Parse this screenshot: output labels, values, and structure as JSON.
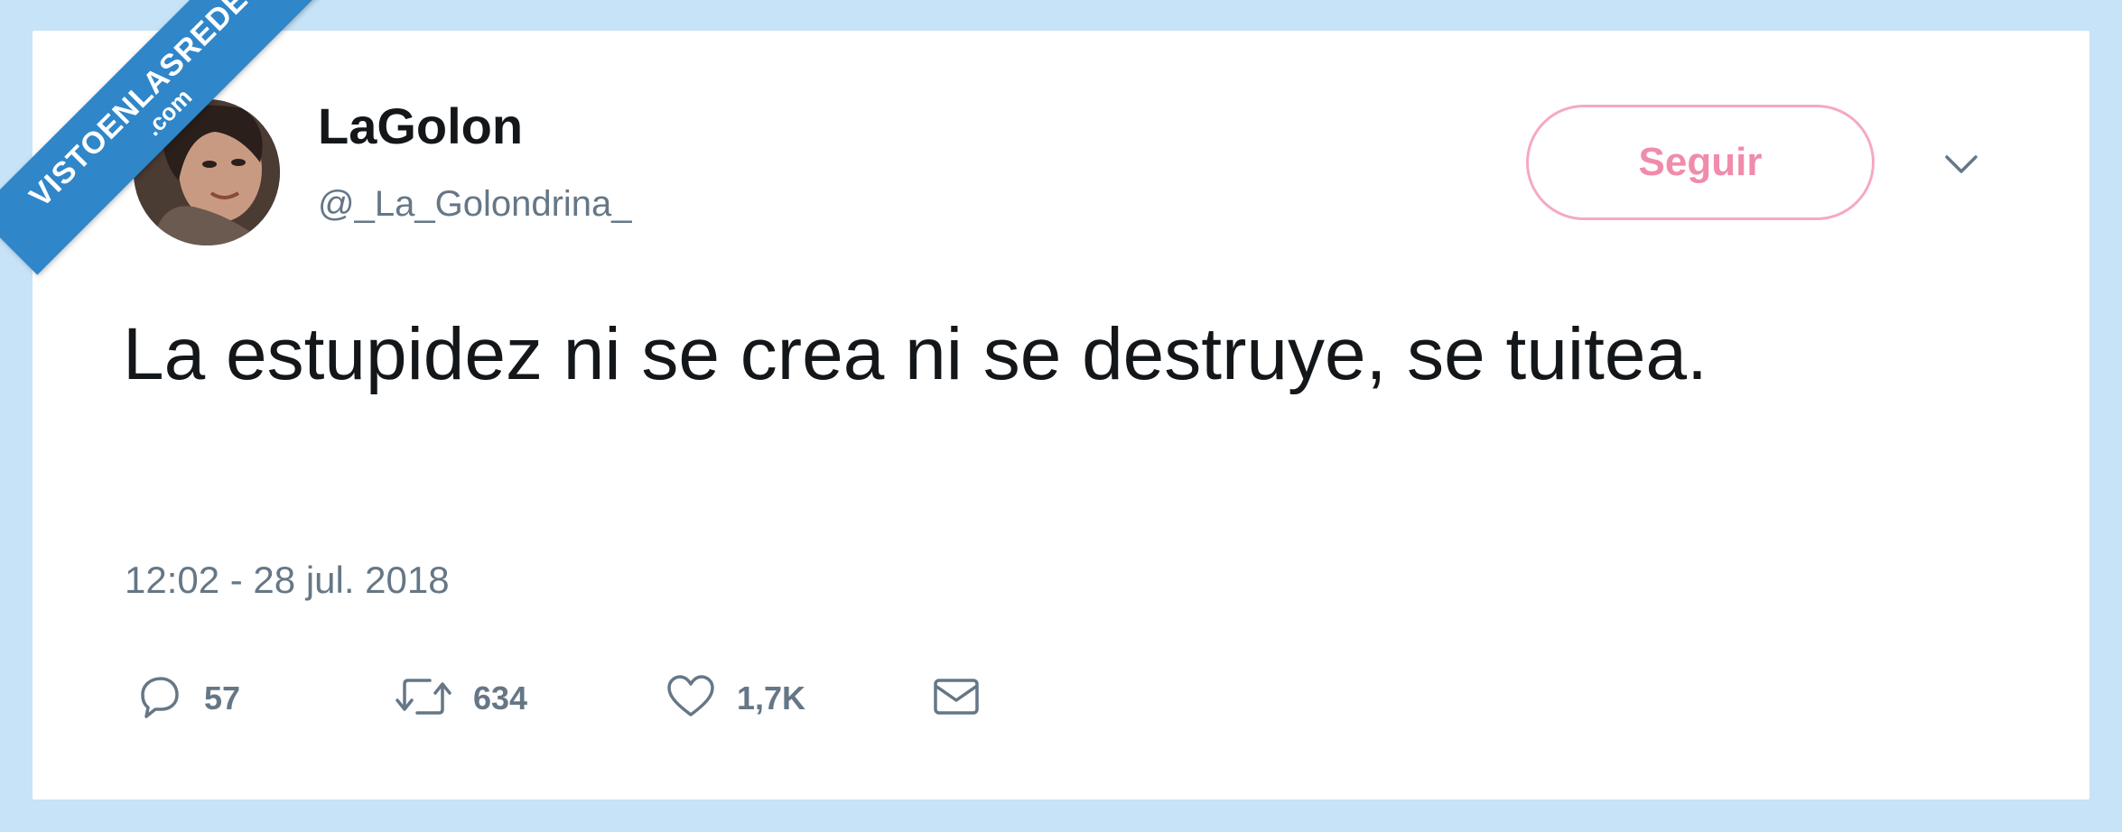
{
  "tweet": {
    "display_name": "LaGolon",
    "handle": "@_La_Golondrina_",
    "follow_label": "Seguir",
    "text": "La estupidez ni se crea ni se destruye, se tuitea.",
    "timestamp": "12:02 - 28 jul. 2018",
    "actions": {
      "reply_count": "57",
      "retweet_count": "634",
      "like_count": "1,7K"
    }
  },
  "watermark": {
    "main": "VISTOENLASREDES",
    "sub": ".com"
  },
  "icons": {
    "reply": "reply-icon",
    "retweet": "retweet-icon",
    "like": "heart-icon",
    "dm": "envelope-icon",
    "caret": "chevron-down-icon"
  },
  "colors": {
    "background": "#c6e3f7",
    "card": "#ffffff",
    "follow_accent": "#f08cab",
    "secondary_text": "#657786",
    "primary_text": "#14171a",
    "watermark": "#2f86c9"
  }
}
